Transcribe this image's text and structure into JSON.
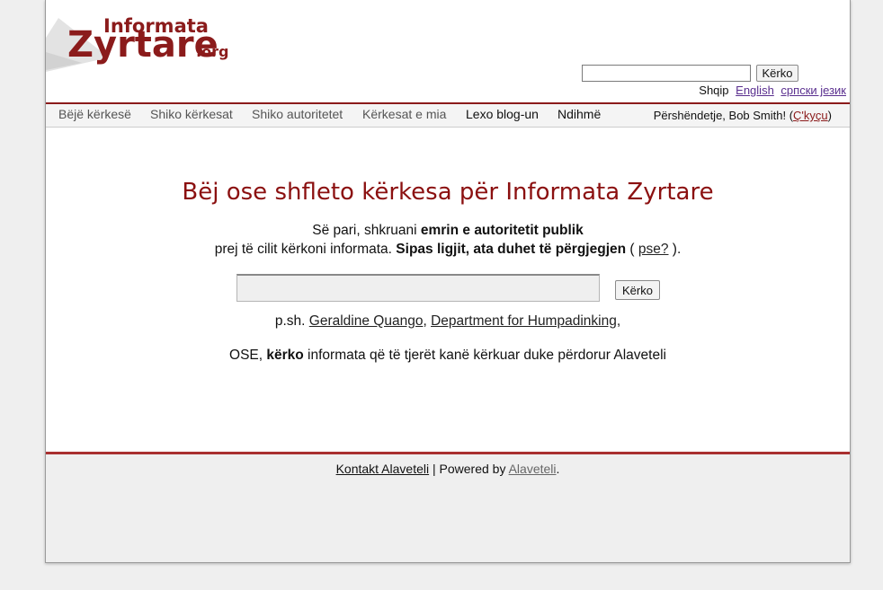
{
  "colors": {
    "accent": "#8b1b1b",
    "title": "#8b1010",
    "page_bg": "#efefef"
  },
  "logo": {
    "line1": "Informata",
    "line2": "Zyrtare",
    "line3": ".org"
  },
  "search_top": {
    "value": "",
    "button": "Kërko"
  },
  "languages": {
    "current": "Shqip",
    "others": [
      "English",
      "српски језик"
    ]
  },
  "nav": {
    "items": [
      "Bëjë kërkesë",
      "Shiko kërkesat",
      "Shiko autoritetet",
      "Kërkesat e mia",
      "Lexo blog-un",
      "Ndihmë"
    ],
    "greeting_prefix": "Përshëndetje, Bob Smith! (",
    "logout": "Ç'kyçu",
    "greeting_suffix": ")"
  },
  "main": {
    "title": "Bëj ose shfleto kërkesa për Informata Zyrtare",
    "intro_a": "Së pari, shkruani ",
    "intro_b": "emrin e autoritetit publik",
    "intro_c": "prej të cilit kërkoni informata. ",
    "intro_d": "Sipas ligjit, ata duhet të përgjegjen",
    "intro_e": " ( ",
    "why_link": "pse?",
    "intro_f": " ).",
    "search_value": "",
    "search_button": "Kërko",
    "examples_prefix": "p.sh. ",
    "example_1": "Geraldine Quango",
    "examples_sep": ", ",
    "example_2": "Department for Humpadinking",
    "examples_suffix": ",",
    "or_a": "OSE, ",
    "or_b": "kërko",
    "or_c": " informata që të tjerët kanë kërkuar duke përdorur Alaveteli"
  },
  "footer": {
    "contact": "Kontakt Alaveteli",
    "sep": " | Powered by ",
    "powered": "Alaveteli",
    "end": "."
  }
}
